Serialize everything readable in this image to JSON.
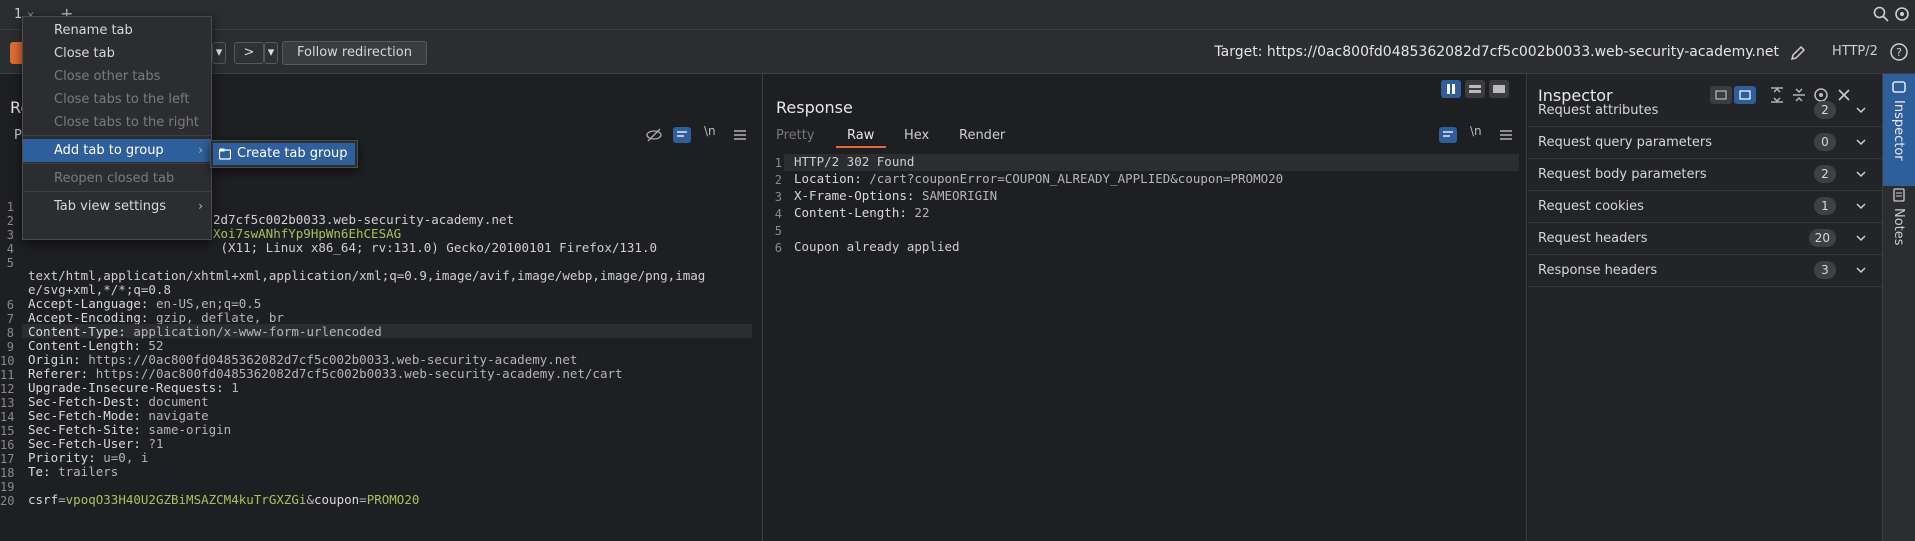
{
  "tabstrip": {
    "tab_label": "1",
    "tab_chevron": "×",
    "plus_label": "+"
  },
  "toolbar": {
    "back_drop": "▾",
    "fwd_label": ">",
    "fwd_drop": "▾",
    "follow_label": "Follow redirection",
    "target_text": "Target: https://0ac800fd0485362082d7cf5c002b0033.web-security-academy.net",
    "http_label": "HTTP/2"
  },
  "context_menu": {
    "items": [
      {
        "label": "Rename tab",
        "enabled": true
      },
      {
        "label": "Close tab",
        "enabled": true
      },
      {
        "label": "Close other tabs",
        "enabled": false
      },
      {
        "label": "Close tabs to the left",
        "enabled": false
      },
      {
        "label": "Close tabs to the right",
        "enabled": false
      },
      {
        "label": "Add tab to group",
        "enabled": true,
        "submenu": true
      },
      {
        "label": "Reopen closed tab",
        "enabled": false
      },
      {
        "label": "Tab view settings",
        "enabled": true,
        "submenu": true
      }
    ],
    "submenu_item": "Create tab group",
    "arrow": "›"
  },
  "request": {
    "title": "Re",
    "subtab": "P",
    "ln_label": "\\n",
    "lines": [
      {
        "n": "1",
        "text": ""
      },
      {
        "n": "2",
        "text": "2d7cf5c002b0033.web-security-academy.net"
      },
      {
        "n": "3",
        "text": "Xoi7swANhfYp9HpWn6EhCESAG"
      },
      {
        "n": "4",
        "text": " (X11; Linux x86_64; rv:131.0) Gecko/20100101 Firefox/131.0"
      },
      {
        "n": "5",
        "text": ""
      },
      {
        "n": "",
        "text": "text/html,application/xhtml+xml,application/xml;q=0.9,image/avif,image/webp,image/png,imag"
      },
      {
        "n": "",
        "text": "e/svg+xml,*/*;q=0.8"
      },
      {
        "n": "6",
        "key": "Accept-Language:",
        "val": " en-US,en;q=0.5"
      },
      {
        "n": "7",
        "key": "Accept-Encoding:",
        "val": " gzip, deflate, br"
      },
      {
        "n": "8",
        "key": "Content-Type:",
        "val": " application/x-www-form-urlencoded"
      },
      {
        "n": "9",
        "key": "Content-Length:",
        "val": " 52"
      },
      {
        "n": "10",
        "key": "Origin:",
        "val": " https://0ac800fd0485362082d7cf5c002b0033.web-security-academy.net"
      },
      {
        "n": "11",
        "key": "Referer:",
        "val": " https://0ac800fd0485362082d7cf5c002b0033.web-security-academy.net/cart"
      },
      {
        "n": "12",
        "key": "Upgrade-Insecure-Requests:",
        "val": " 1"
      },
      {
        "n": "13",
        "key": "Sec-Fetch-Dest:",
        "val": " document"
      },
      {
        "n": "14",
        "key": "Sec-Fetch-Mode:",
        "val": " navigate"
      },
      {
        "n": "15",
        "key": "Sec-Fetch-Site:",
        "val": " same-origin"
      },
      {
        "n": "16",
        "key": "Sec-Fetch-User:",
        "val": " ?1"
      },
      {
        "n": "17",
        "key": "Priority:",
        "val": " u=0, i"
      },
      {
        "n": "18",
        "key": "Te:",
        "val": " trailers"
      },
      {
        "n": "19",
        "text": ""
      },
      {
        "n": "20",
        "body_k1": "csrf",
        "body_v1": "vpoqO33H40U2GZBiMSAZCM4kuTrGXZGi",
        "body_amp": "&",
        "body_k2": "coupon",
        "body_v2": "PROMO20",
        "eq": "="
      }
    ]
  },
  "response": {
    "title": "Response",
    "tabs": [
      "Pretty",
      "Raw",
      "Hex",
      "Render"
    ],
    "active_tab": "Raw",
    "ln_label": "\\n",
    "lines": [
      {
        "n": "1",
        "text": "HTTP/2 302 Found"
      },
      {
        "n": "2",
        "key": "Location:",
        "val": " /cart?couponError=COUPON_ALREADY_APPLIED&coupon=PROMO20"
      },
      {
        "n": "3",
        "key": "X-Frame-Options:",
        "val": " SAMEORIGIN"
      },
      {
        "n": "4",
        "key": "Content-Length:",
        "val": " 22"
      },
      {
        "n": "5",
        "text": ""
      },
      {
        "n": "6",
        "text": "Coupon already applied"
      }
    ]
  },
  "inspector": {
    "title": "Inspector",
    "rows": [
      {
        "label": "Request attributes",
        "count": "2"
      },
      {
        "label": "Request query parameters",
        "count": "0"
      },
      {
        "label": "Request body parameters",
        "count": "2"
      },
      {
        "label": "Request cookies",
        "count": "1"
      },
      {
        "label": "Request headers",
        "count": "20"
      },
      {
        "label": "Response headers",
        "count": "3"
      }
    ]
  },
  "rail": {
    "inspector_label": "Inspector",
    "notes_label": "Notes"
  },
  "colors": {
    "accent": "#2f5f9a",
    "send": "#e06c34",
    "green": "#a6c35a"
  }
}
